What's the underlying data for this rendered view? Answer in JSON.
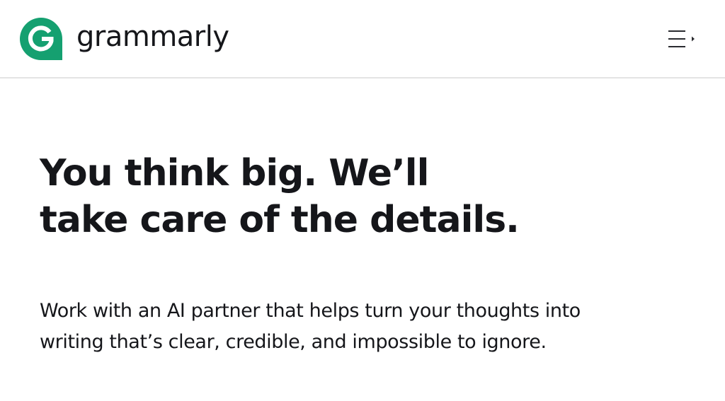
{
  "header": {
    "brand_name": "grammarly",
    "brand_color": "#15a070",
    "logo_icon": "grammarly-g-logo",
    "menu_icon": "hamburger-menu-icon"
  },
  "hero": {
    "headline_lines": [
      "You think big. We’ll",
      "take care of the details."
    ],
    "subtext_lines": [
      "Work with an AI partner that helps turn your thoughts into",
      "writing that’s clear, credible, and impossible to ignore."
    ]
  }
}
